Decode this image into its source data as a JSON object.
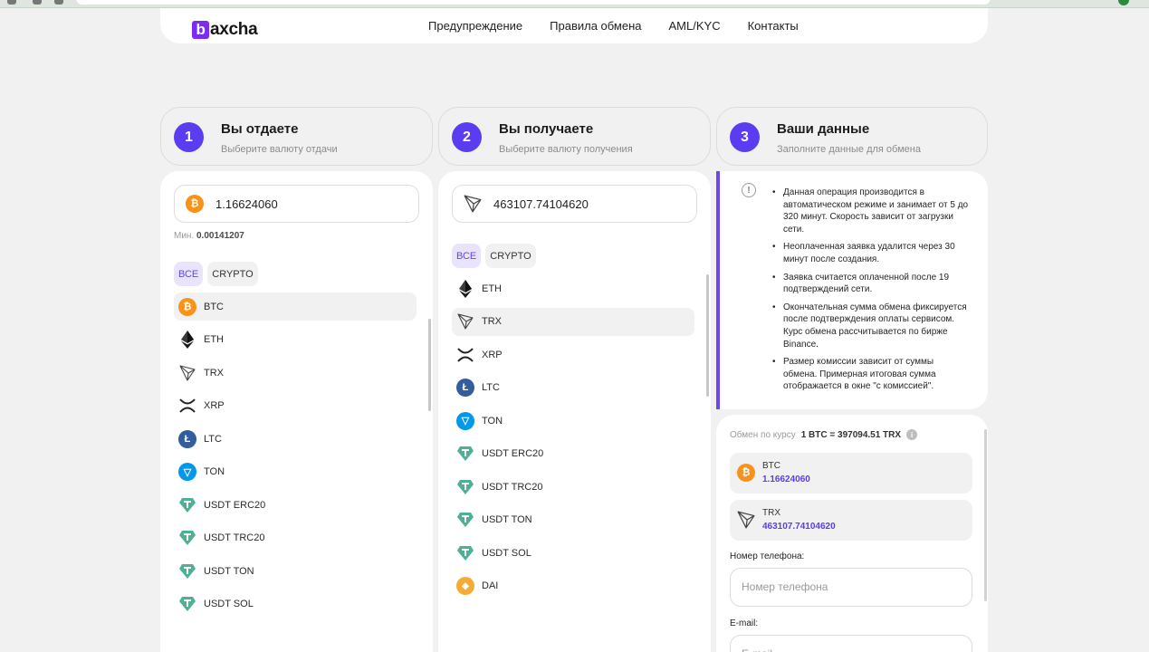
{
  "header": {
    "logo_letter": "b",
    "logo_rest": "axcha",
    "nav": [
      "Предупреждение",
      "Правила обмена",
      "AML/KYC",
      "Контакты"
    ]
  },
  "steps": [
    {
      "num": "1",
      "title": "Вы отдаете",
      "sub": "Выберите валюту отдачи"
    },
    {
      "num": "2",
      "title": "Вы получаете",
      "sub": "Выберите валюту получения"
    },
    {
      "num": "3",
      "title": "Ваши данные",
      "sub": "Заполните данные для обмена"
    }
  ],
  "give": {
    "amount": "1.16624060",
    "min_label": "Мин.",
    "min_value": "0.00141207",
    "filters": [
      "ВСЕ",
      "CRYPTO"
    ],
    "items": [
      "BTC",
      "ETH",
      "TRX",
      "XRP",
      "LTC",
      "TON",
      "USDT ERC20",
      "USDT TRC20",
      "USDT TON",
      "USDT SOL"
    ]
  },
  "receive": {
    "amount": "463107.74104620",
    "filters": [
      "ВСЕ",
      "CRYPTO"
    ],
    "items": [
      "ETH",
      "TRX",
      "XRP",
      "LTC",
      "TON",
      "USDT ERC20",
      "USDT TRC20",
      "USDT TON",
      "USDT SOL",
      "DAI"
    ]
  },
  "info": {
    "icon": "!",
    "bullets": [
      "Данная операция производится в автоматическом режиме и занимает от 5 до 320 минут. Скорость зависит от загрузки сети.",
      "Неоплаченная заявка удалится через 30 минут после создания.",
      "Заявка считается оплаченной после 19 подтверждений сети.",
      "Окончательная сумма обмена фиксируется после подтверждения оплаты сервисом. Курс обмена рассчитывается по бирже Binance.",
      "Размер комиссии зависит от суммы обмена. Примерная итоговая сумма отображается в окне \"с комиссией\"."
    ]
  },
  "summary": {
    "rate_label": "Обмен по курсу",
    "rate_value": "1 BTC = 397094.51 TRX",
    "give_currency": "BTC",
    "give_amount": "1.16624060",
    "get_currency": "TRX",
    "get_amount": "463107.74104620",
    "phone_label": "Номер телефона:",
    "phone_placeholder": "Номер телефона",
    "email_label": "E-mail:",
    "email_placeholder": "E-mail"
  },
  "colors": {
    "accent": "#5b3cf0",
    "btc": "#f7931a",
    "ltc": "#345d9d",
    "ton": "#0098ea",
    "usdt": "#50af95",
    "dai": "#f5ac37"
  }
}
